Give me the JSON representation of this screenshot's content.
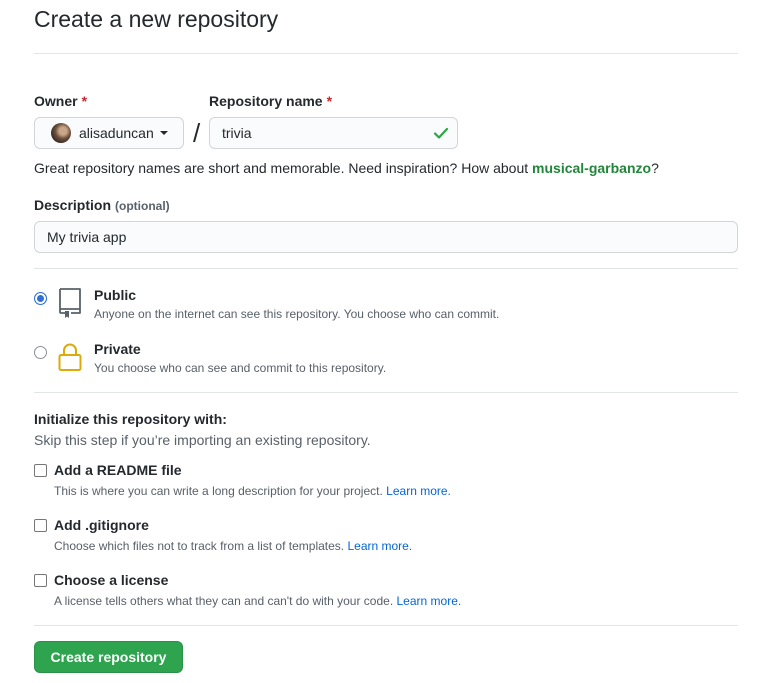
{
  "page": {
    "title": "Create a new repository"
  },
  "owner": {
    "label": "Owner",
    "required_mark": "*",
    "value": "alisaduncan"
  },
  "separator": "/",
  "repo_name": {
    "label": "Repository name",
    "required_mark": "*",
    "value": "trivia"
  },
  "name_hint": {
    "text": "Great repository names are short and memorable. Need inspiration? How about ",
    "suggestion": "musical-garbanzo",
    "end": "?"
  },
  "description": {
    "label": "Description",
    "optional": "(optional)",
    "value": "My trivia app"
  },
  "visibility": {
    "selected": "Public",
    "options": [
      {
        "title": "Public",
        "description": "Anyone on the internet can see this repository. You choose who can commit.",
        "icon": "repo-icon"
      },
      {
        "title": "Private",
        "description": "You choose who can see and commit to this repository.",
        "icon": "lock-icon"
      }
    ]
  },
  "init": {
    "title": "Initialize this repository with:",
    "subtitle": "Skip this step if you’re importing an existing repository.",
    "options": [
      {
        "title": "Add a README file",
        "description": "This is where you can write a long description for your project.",
        "link": "Learn more.",
        "checked": false
      },
      {
        "title": "Add .gitignore",
        "description": "Choose which files not to track from a list of templates.",
        "link": "Learn more.",
        "checked": false
      },
      {
        "title": "Choose a license",
        "description": "A license tells others what they can and can't do with your code.",
        "link": "Learn more.",
        "checked": false
      }
    ]
  },
  "submit": {
    "label": "Create repository"
  },
  "colors": {
    "primary_button": "#2ea44f",
    "success": "#28a745",
    "suggestion": "#22863a",
    "link": "#0366d6",
    "required": "#cb2431",
    "lock": "#dbab09",
    "radio_selected": "#2f6fd8"
  }
}
